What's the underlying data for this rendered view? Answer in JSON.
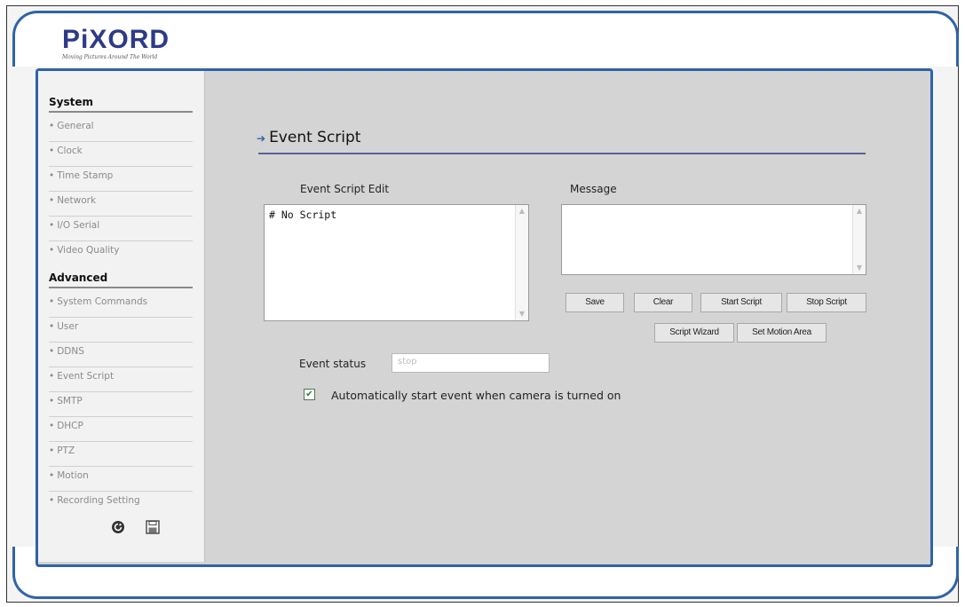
{
  "brand": {
    "logo": "PiXORD",
    "tagline": "Moving Pictures Around The World"
  },
  "sidebar": {
    "system_heading": "System",
    "system_items": [
      {
        "label": "General"
      },
      {
        "label": "Clock"
      },
      {
        "label": "Time Stamp"
      },
      {
        "label": "Network"
      },
      {
        "label": "I/O Serial"
      },
      {
        "label": "Video Quality"
      }
    ],
    "advanced_heading": "Advanced",
    "advanced_items": [
      {
        "label": "System Commands"
      },
      {
        "label": "User"
      },
      {
        "label": "DDNS"
      },
      {
        "label": "Event Script"
      },
      {
        "label": "SMTP"
      },
      {
        "label": "DHCP"
      },
      {
        "label": "PTZ"
      },
      {
        "label": "Motion"
      },
      {
        "label": "Recording Setting"
      }
    ],
    "bottom_icons": [
      "refresh-icon",
      "save-disk-icon"
    ]
  },
  "page": {
    "title": "Event Script",
    "editor_label": "Event Script Edit",
    "editor_value": "# No Script",
    "message_label": "Message",
    "message_value": ""
  },
  "buttons": {
    "save": "Save",
    "clear": "Clear",
    "start_script": "Start Script",
    "stop_script": "Stop Script",
    "script_wizard": "Script Wizard",
    "set_motion_area": "Set Motion Area"
  },
  "status": {
    "label": "Event status",
    "value": "stop"
  },
  "autostart": {
    "checked": true,
    "label": "Automatically start event when camera is turned on"
  },
  "colors": {
    "accent_blue": "#2f63a8",
    "logo_navy": "#2d3a88",
    "content_gray": "#d4d4d4"
  }
}
